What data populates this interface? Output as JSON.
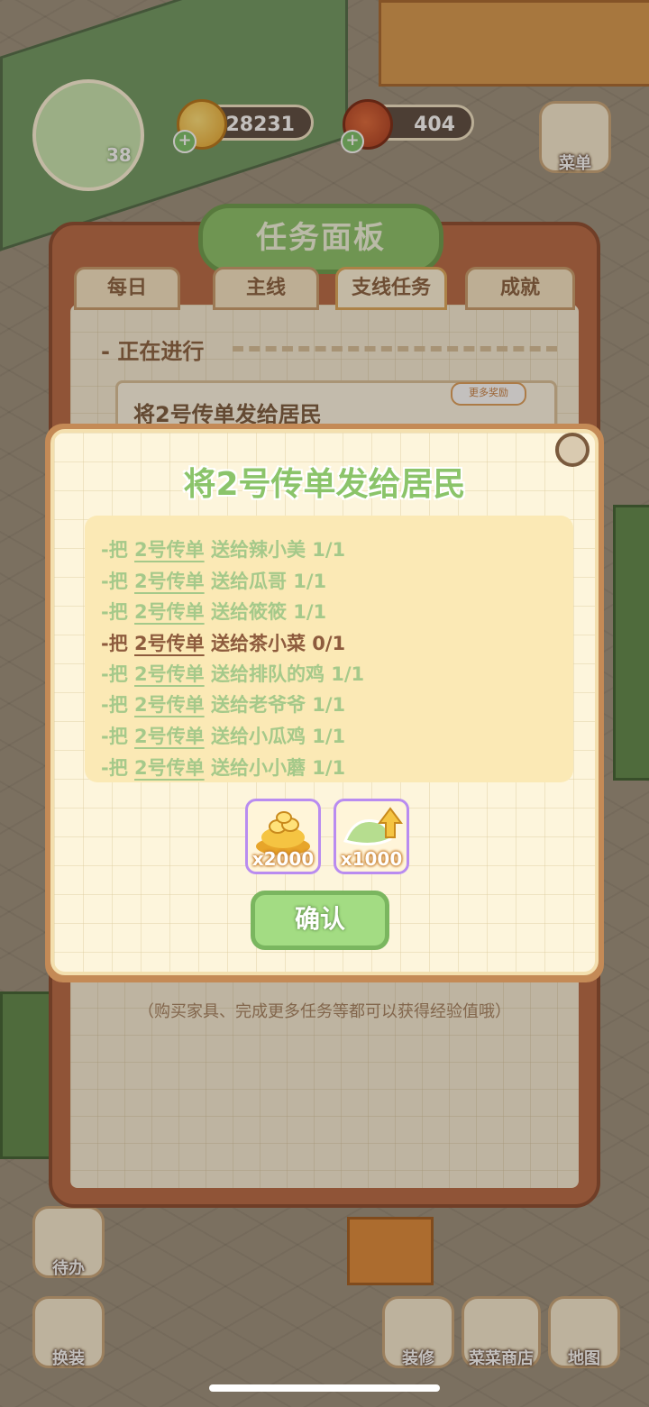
{
  "hud": {
    "coins": "28231",
    "food": "404",
    "level": "38",
    "menu_label": "菜单"
  },
  "side_buttons": {
    "todo": "待办",
    "dress": "换装",
    "decorate": "装修",
    "shop": "菜菜商店",
    "map": "地图"
  },
  "task_panel": {
    "title": "任务面板",
    "tabs": [
      "每日",
      "主线",
      "支线任务",
      "成就"
    ],
    "active_tab": "支线任务",
    "section_label": "- 正在进行",
    "card_title": "将2号传单发给居民",
    "more_badge": "更多奖励",
    "footer_hint": "（购买家具、完成更多任务等都可以获得经验值哦）"
  },
  "modal": {
    "title": "将2号传单发给居民",
    "items": [
      {
        "prefix": "-把 ",
        "flyer": "2号传单",
        "text": " 送给辣小美 1/1",
        "done": true
      },
      {
        "prefix": "-把 ",
        "flyer": "2号传单",
        "text": " 送给瓜哥 1/1",
        "done": true
      },
      {
        "prefix": "-把 ",
        "flyer": "2号传单",
        "text": " 送给筱筱 1/1",
        "done": true
      },
      {
        "prefix": "-把 ",
        "flyer": "2号传单",
        "text": " 送给茶小菜 0/1",
        "done": false
      },
      {
        "prefix": "-把 ",
        "flyer": "2号传单",
        "text": " 送给排队的鸡 1/1",
        "done": true
      },
      {
        "prefix": "-把 ",
        "flyer": "2号传单",
        "text": " 送给老爷爷 1/1",
        "done": true
      },
      {
        "prefix": "-把 ",
        "flyer": "2号传单",
        "text": " 送给小瓜鸡 1/1",
        "done": true
      },
      {
        "prefix": "-把 ",
        "flyer": "2号传单",
        "text": " 送给小小蘑 1/1",
        "done": true
      }
    ],
    "rewards": [
      {
        "icon": "gold-coin-pile-icon",
        "qty": "x2000"
      },
      {
        "icon": "exp-leaf-up-icon",
        "qty": "x1000"
      }
    ],
    "confirm_label": "确认"
  },
  "colors": {
    "done_text": "#a5c98a",
    "pending_text": "#8d5b3d",
    "accent_green": "#8bc46a"
  }
}
